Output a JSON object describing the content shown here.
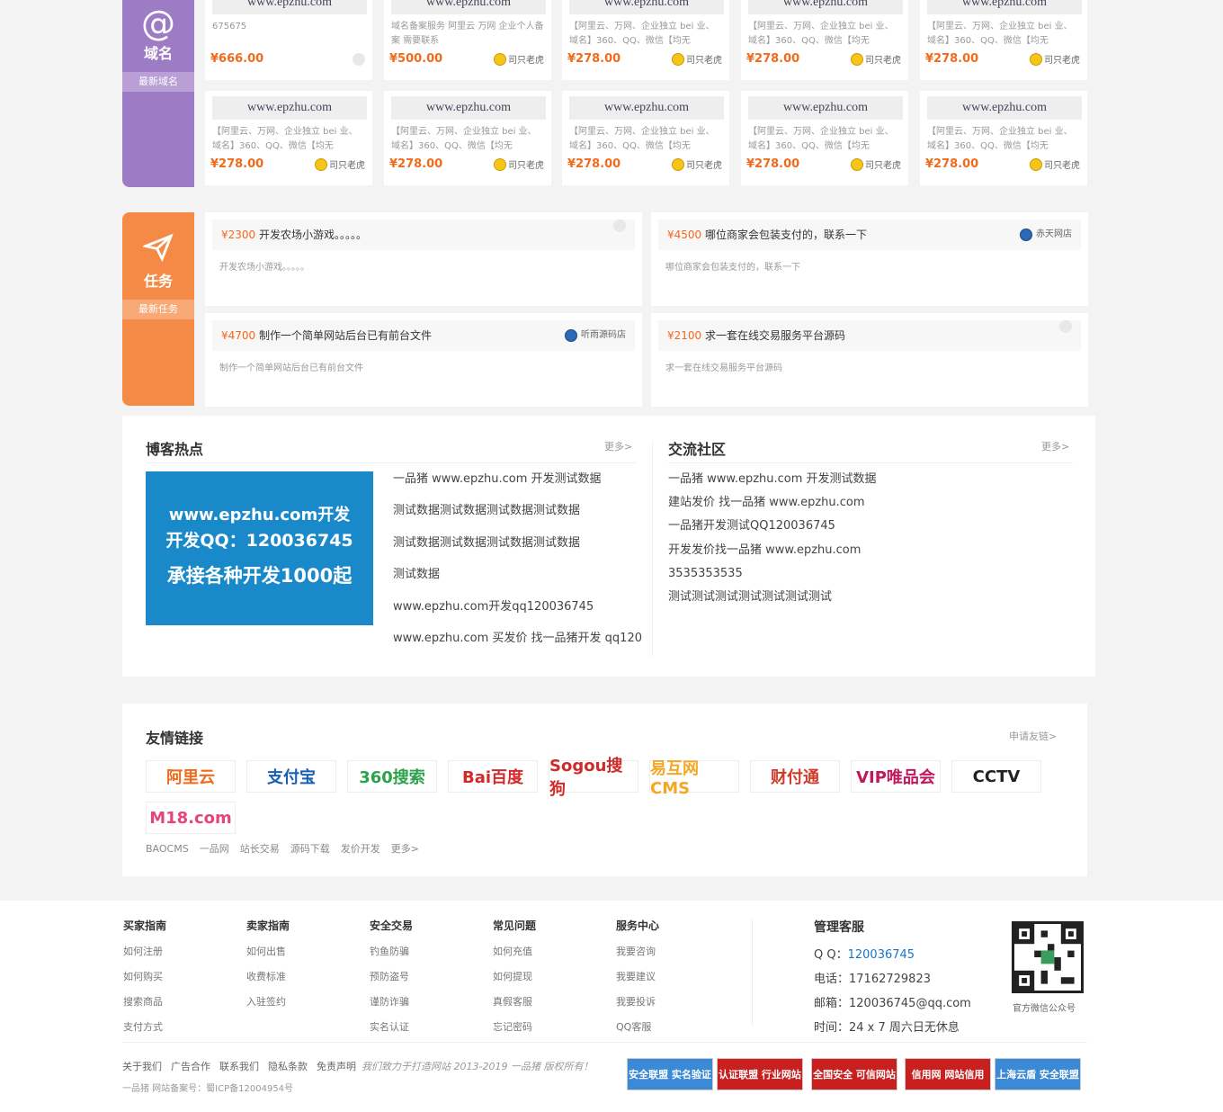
{
  "domain_section": {
    "icon": "@",
    "label": "域名",
    "tag": "最新域名",
    "cards": [
      {
        "name": "www.epzhu.com",
        "desc": "675675",
        "price": "¥666.00",
        "seller": ""
      },
      {
        "name": "www.epzhu.com",
        "desc": "域名备案服务 阿里云 万网 企业个人备案 需要联系",
        "price": "¥500.00",
        "seller": "司只老虎"
      },
      {
        "name": "www.epzhu.com",
        "desc": "【阿里云、万网、企业独立 bei 业、域名】360、QQ、微信【均无",
        "price": "¥278.00",
        "seller": "司只老虎"
      },
      {
        "name": "www.epzhu.com",
        "desc": "【阿里云、万网、企业独立 bei 业、域名】360、QQ、微信【均无",
        "price": "¥278.00",
        "seller": "司只老虎"
      },
      {
        "name": "www.epzhu.com",
        "desc": "【阿里云、万网、企业独立 bei 业、域名】360、QQ、微信【均无",
        "price": "¥278.00",
        "seller": "司只老虎"
      },
      {
        "name": "www.epzhu.com",
        "desc": "【阿里云、万网、企业独立 bei 业、域名】360、QQ、微信【均无",
        "price": "¥278.00",
        "seller": "司只老虎"
      },
      {
        "name": "www.epzhu.com",
        "desc": "【阿里云、万网、企业独立 bei 业、域名】360、QQ、微信【均无",
        "price": "¥278.00",
        "seller": "司只老虎"
      },
      {
        "name": "www.epzhu.com",
        "desc": "【阿里云、万网、企业独立 bei 业、域名】360、QQ、微信【均无",
        "price": "¥278.00",
        "seller": "司只老虎"
      },
      {
        "name": "www.epzhu.com",
        "desc": "【阿里云、万网、企业独立 bei 业、域名】360、QQ、微信【均无",
        "price": "¥278.00",
        "seller": "司只老虎"
      },
      {
        "name": "www.epzhu.com",
        "desc": "【阿里云、万网、企业独立 bei 业、域名】360、QQ、微信【均无",
        "price": "¥278.00",
        "seller": "司只老虎"
      }
    ]
  },
  "task_section": {
    "label": "任务",
    "tag": "最新任务",
    "tasks": [
      {
        "price": "¥2300",
        "title": "开发农场小游戏。。。。。",
        "desc": "开发农场小游戏。。。。。",
        "user": ""
      },
      {
        "price": "¥4500",
        "title": "哪位商家会包装支付的，联系一下",
        "desc": "哪位商家会包装支付的，联系一下",
        "user": "赤天网店"
      },
      {
        "price": "¥4700",
        "title": "制作一个简单网站后台已有前台文件",
        "desc": "制作一个简单网站后台已有前台文件",
        "user": "听雨源码店"
      },
      {
        "price": "¥2100",
        "title": "求一套在线交易服务平台源码",
        "desc": "求一套在线交易服务平台源码",
        "user": ""
      }
    ]
  },
  "blog": {
    "title": "博客热点",
    "more": "更多>",
    "banner_lines": [
      "www.epzhu.com开发",
      "开发QQ：120036745",
      "承接各种开发1000起"
    ],
    "items": [
      "一品猪 www.epzhu.com 开发测试数据",
      "测试数据测试数据测试数据测试数据",
      "测试数据测试数据测试数据测试数据",
      "测试数据",
      "www.epzhu.com开发qq120036745",
      "www.epzhu.com 买发价 找一品猪开发 qq120"
    ]
  },
  "community": {
    "title": "交流社区",
    "more": "更多>",
    "items": [
      "一品猪 www.epzhu.com 开发测试数据",
      "建站发价 找一品猪 www.epzhu.com",
      "一品猪开发测试QQ120036745",
      "开发发价找一品猪 www.epzhu.com",
      "3535353535",
      "测试测试测试测试测试测试测试"
    ]
  },
  "links": {
    "title": "友情链接",
    "apply": "申请友链>",
    "logos": [
      "阿里云",
      "支付宝",
      "360搜索",
      "Bai百度",
      "Sogou搜狗",
      "易互网CMS",
      "财付通",
      "VIP唯品会",
      "CCTV",
      "M18.com"
    ],
    "text_links": [
      "BAOCMS",
      "一品网",
      "站长交易",
      "源码下载",
      "发价开发",
      "更多>"
    ]
  },
  "footer": {
    "cols": [
      {
        "title": "买家指南",
        "items": [
          "如何注册",
          "如何购买",
          "搜索商品",
          "支付方式"
        ]
      },
      {
        "title": "卖家指南",
        "items": [
          "如何出售",
          "收费标准",
          "入驻签约"
        ]
      },
      {
        "title": "安全交易",
        "items": [
          "钓鱼防骗",
          "预防盗号",
          "谨防诈骗",
          "实名认证"
        ]
      },
      {
        "title": "常见问题",
        "items": [
          "如何充值",
          "如何提现",
          "真假客服",
          "忘记密码"
        ]
      },
      {
        "title": "服务中心",
        "items": [
          "我要咨询",
          "我要建议",
          "我要投诉",
          "QQ客服"
        ]
      }
    ],
    "service": {
      "title": "管理客服",
      "qq_label": "Q Q：",
      "qq": "120036745",
      "phone": "电话：17162729823",
      "email": "邮箱：120036745@qq.com",
      "time": "时间：24 x 7 周六日无休息"
    },
    "qr_caption": "官方微信公众号",
    "bottom_links": [
      "关于我们",
      "广告合作",
      "联系我们",
      "隐私条款",
      "免责声明"
    ],
    "slogan": "我们致力于打造网站 2013-2019 一品猪 版权所有！",
    "icp": "一品猪 网站备案号：蜀ICP备12004954号",
    "badges": [
      "安全联盟 实名验证",
      "认证联盟 行业网站",
      "全国安全 可信网站",
      "信用网 网站信用",
      "上海云盾 安全联盟"
    ]
  },
  "colors": {
    "purple": "#9e7bc5",
    "orange": "#f48a45",
    "price": "#f26a1b",
    "banner": "#1989c9"
  }
}
